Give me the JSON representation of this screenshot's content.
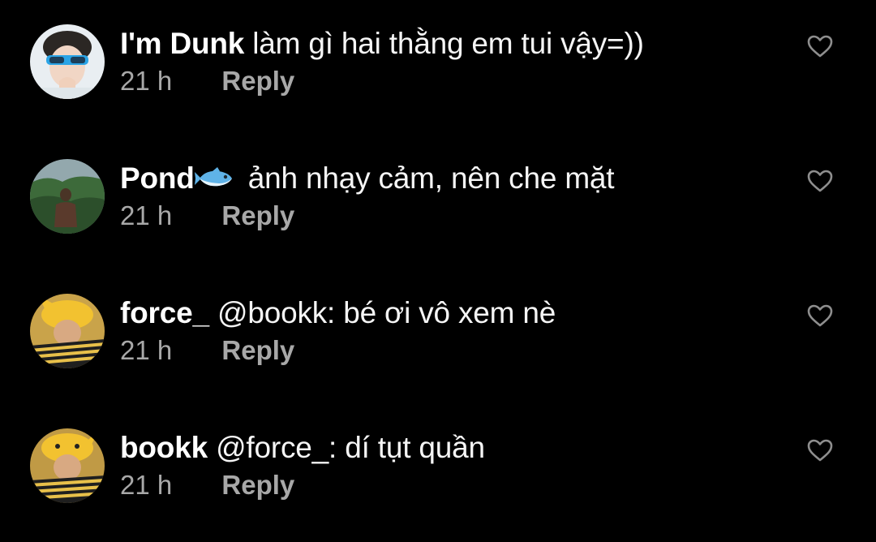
{
  "comments": [
    {
      "username": "I'm Dunk",
      "text": "làm gì hai thằng em tui vậy=))",
      "time": "21 h",
      "reply_label": "Reply",
      "like_icon": "heart-outline-icon"
    },
    {
      "username": "Pond",
      "username_emoji": "fish-icon",
      "text": "ảnh nhạy cảm, nên che mặt",
      "time": "21 h",
      "reply_label": "Reply",
      "like_icon": "heart-outline-icon"
    },
    {
      "username": "force_",
      "text": "@bookk: bé ơi vô xem nè",
      "time": "21 h",
      "reply_label": "Reply",
      "like_icon": "heart-outline-icon"
    },
    {
      "username": "bookk",
      "text": "@force_: dí tụt quần",
      "time": "21 h",
      "reply_label": "Reply",
      "like_icon": "heart-outline-icon"
    }
  ],
  "colors": {
    "background": "#000000",
    "text": "#ffffff",
    "secondary_text": "#a8a8a8",
    "heart_outline": "#8e8e8e"
  }
}
